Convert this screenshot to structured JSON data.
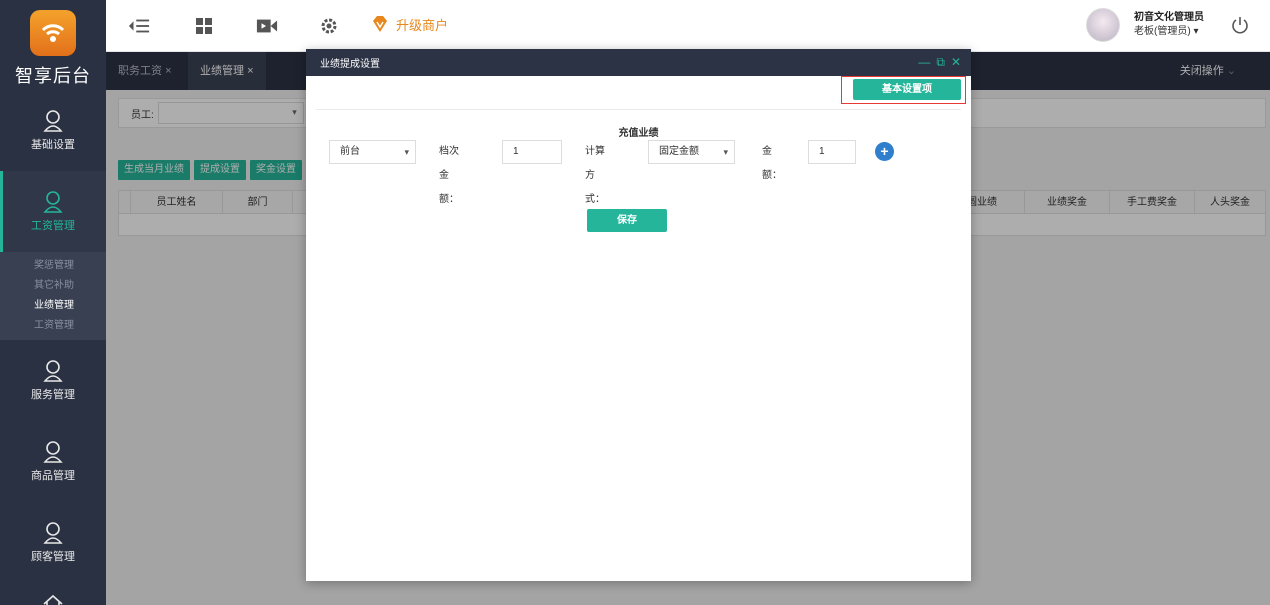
{
  "logo": {
    "text": "智享后台"
  },
  "sidebar": {
    "items": [
      {
        "label": "基础设置"
      },
      {
        "label": "工资管理"
      },
      {
        "label": "服务管理"
      },
      {
        "label": "商品管理"
      },
      {
        "label": "顾客管理"
      }
    ],
    "subitems": [
      "奖惩管理",
      "其它补助",
      "业绩管理",
      "工资管理"
    ],
    "active_color": "#25b59a"
  },
  "topbar": {
    "upgrade_label": "升级商户",
    "user_name": "初音文化管理员",
    "user_role": "老板(管理员)"
  },
  "tabs": {
    "items": [
      {
        "label": "职务工资"
      },
      {
        "label": "业绩管理"
      }
    ],
    "close_ops": "关闭操作"
  },
  "page": {
    "filter_label": "员工:",
    "actions": [
      "生成当月业绩",
      "提成设置",
      "奖金设置"
    ],
    "columns_left": [
      "员工姓名",
      "部门"
    ],
    "columns_right": [
      "圆业绩",
      "业绩奖金",
      "手工费奖金",
      "人头奖金"
    ]
  },
  "modal": {
    "title": "业绩提成设置",
    "basic_button": "基本设置项",
    "section_title": "充值业绩",
    "dept_select": "前台",
    "tier_label": "档次金额：",
    "tier_value": "1",
    "calc_label": "计算方式：",
    "calc_select": "固定金额",
    "amount_label": "金额：",
    "amount_value": "1",
    "save_button": "保存"
  },
  "colors": {
    "accent": "#25b59a",
    "sidebar_bg": "#2a3142",
    "header_bg": "#2c3345",
    "highlight_border": "#e53935",
    "plus_blue": "#2f7fcc"
  }
}
